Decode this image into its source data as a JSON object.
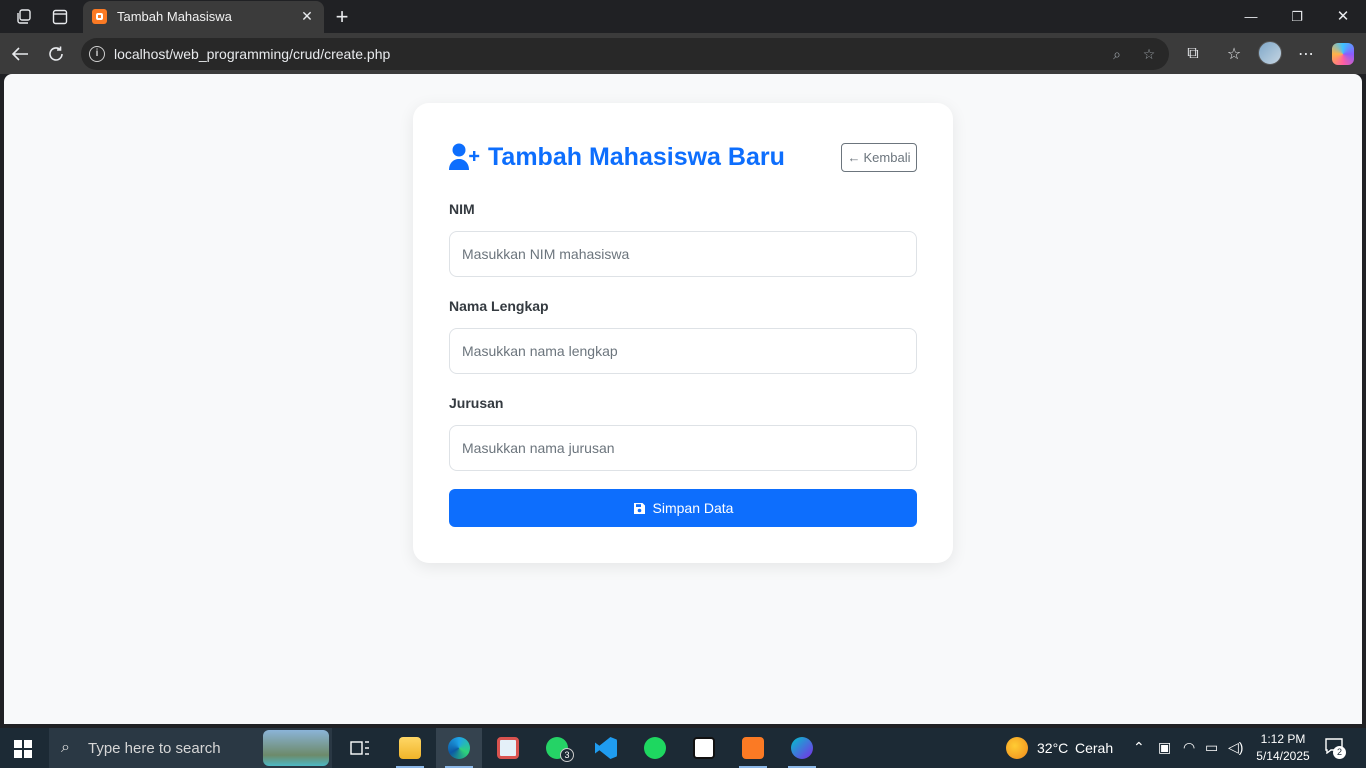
{
  "browser": {
    "tab_title": "Tambah Mahasiswa",
    "url": "localhost/web_programming/crud/create.php"
  },
  "page": {
    "title": "Tambah Mahasiswa Baru",
    "back_label": "Kembali",
    "fields": [
      {
        "label": "NIM",
        "placeholder": "Masukkan NIM mahasiswa",
        "value": ""
      },
      {
        "label": "Nama Lengkap",
        "placeholder": "Masukkan nama lengkap",
        "value": ""
      },
      {
        "label": "Jurusan",
        "placeholder": "Masukkan nama jurusan",
        "value": ""
      }
    ],
    "submit_label": "Simpan Data",
    "accent_color": "#0d6efd"
  },
  "taskbar": {
    "search_placeholder": "Type here to search",
    "whatsapp_badge": "3",
    "weather_temp": "32°C",
    "weather_desc": "Cerah",
    "time": "1:12 PM",
    "date": "5/14/2025",
    "notification_count": "2"
  }
}
